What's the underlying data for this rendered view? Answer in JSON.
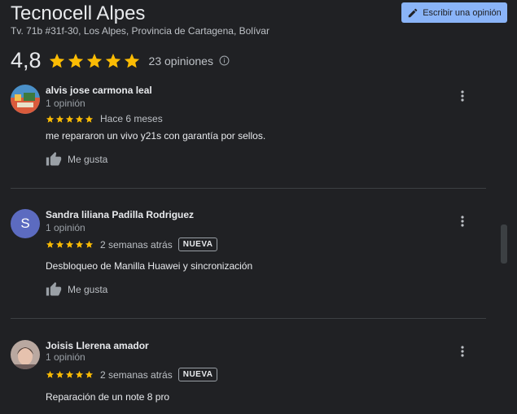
{
  "header": {
    "title": "Tecnocell Alpes",
    "address": "Tv. 71b #31f-30, Los Alpes, Provincia de Cartagena, Bolívar",
    "write_review_label": "Escribir una opinión"
  },
  "summary": {
    "rating": "4,8",
    "count": "23 opiniones",
    "stars": 5
  },
  "colors": {
    "star": "#fbbc04",
    "accent": "#8ab4f8",
    "background": "#202124"
  },
  "icons": {
    "write": "pencil-icon",
    "info": "info-icon",
    "like": "thumbs-up-icon",
    "more": "more-vert-icon"
  },
  "reviews": [
    {
      "name": "alvis jose carmona leal",
      "count": "1 opinión",
      "stars": 5,
      "date": "Hace 6 meses",
      "badge": "",
      "text": "me repararon un vivo y21s con garantía por sellos.",
      "like_label": "Me gusta"
    },
    {
      "name": "Sandra liliana Padilla Rodriguez",
      "avatar_letter": "S",
      "count": "1 opinión",
      "stars": 5,
      "date": "2 semanas atrás",
      "badge": "NUEVA",
      "text": "Desbloqueo de Manilla Huawei y sincronización",
      "like_label": "Me gusta"
    },
    {
      "name": "Joisis Llerena amador",
      "count": "1 opinión",
      "stars": 5,
      "date": "2 semanas atrás",
      "badge": "NUEVA",
      "text": "Reparación de un note 8 pro"
    }
  ]
}
